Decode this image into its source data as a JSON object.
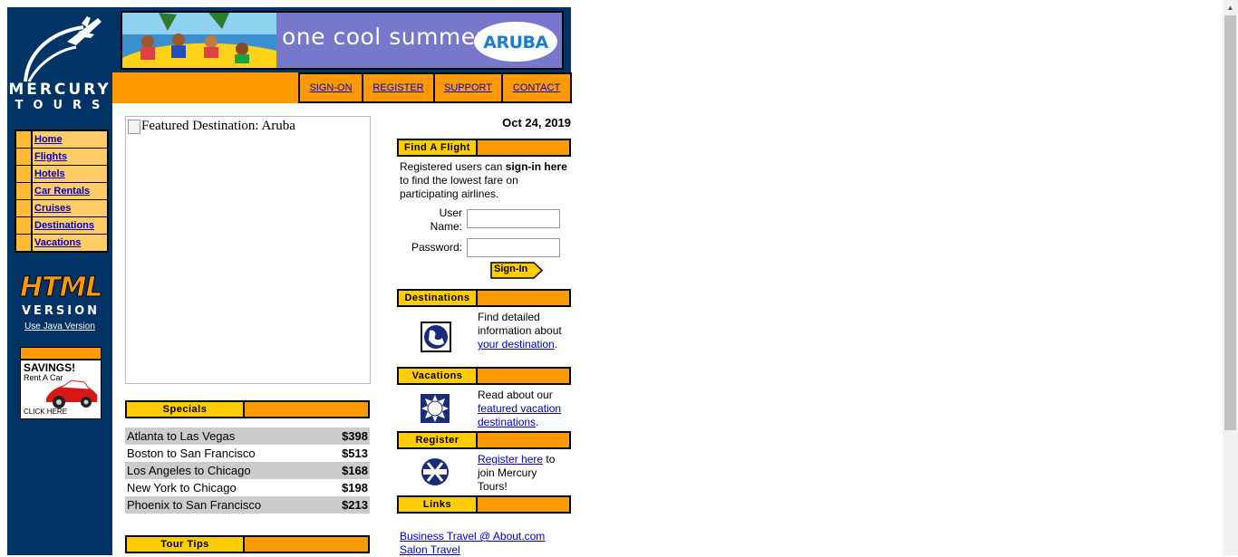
{
  "logo": {
    "line1": "MERCURY",
    "line2": "TOURS"
  },
  "nav": {
    "items": [
      {
        "label": "Home"
      },
      {
        "label": "Flights"
      },
      {
        "label": "Hotels"
      },
      {
        "label": "Car Rentals"
      },
      {
        "label": "Cruises"
      },
      {
        "label": "Destinations"
      },
      {
        "label": "Vacations"
      }
    ]
  },
  "badge": {
    "line1": "HTML",
    "line2": "VERSION",
    "java_link": "Use Java Version"
  },
  "ad": {
    "savings": "SAVINGS!",
    "rent": "Rent A Car",
    "click": "CLICK HERE"
  },
  "banner": {
    "tagline": "one cool summer",
    "logo_text": "ARUBA"
  },
  "top_links": [
    {
      "label": "SIGN-ON"
    },
    {
      "label": "REGISTER"
    },
    {
      "label": "SUPPORT"
    },
    {
      "label": "CONTACT"
    }
  ],
  "featured": {
    "alt": "Featured Destination: Aruba"
  },
  "specials": {
    "header": "Specials",
    "rows": [
      {
        "route": "Atlanta to Las Vegas",
        "price": "$398"
      },
      {
        "route": "Boston to San Francisco",
        "price": "$513"
      },
      {
        "route": "Los Angeles to Chicago",
        "price": "$168"
      },
      {
        "route": "New York to Chicago",
        "price": "$198"
      },
      {
        "route": "Phoenix to San Francisco",
        "price": "$213"
      }
    ]
  },
  "tour_tips": {
    "header": "Tour Tips"
  },
  "date": "Oct 24, 2019",
  "find_flight": {
    "header": "Find A Flight",
    "text_pre": "Registered users can ",
    "text_bold": "sign-in here",
    "text_post": " to find the lowest fare on participating airlines.",
    "username_label_1": "User",
    "username_label_2": "Name:",
    "password_label": "Password:",
    "username_value": "",
    "password_value": "",
    "signin_label": "Sign-In"
  },
  "destinations": {
    "header": "Destinations",
    "text_pre": "Find detailed information about ",
    "link": "your destination",
    "text_post": "."
  },
  "vacations": {
    "header": "Vacations",
    "text_pre": "Read about our ",
    "link": "featured vacation destinations",
    "text_post": "."
  },
  "register": {
    "header": "Register",
    "link": "Register here",
    "text_post": " to join Mercury Tours!"
  },
  "links": {
    "header": "Links",
    "items": [
      {
        "label": "Business Travel @ About.com"
      },
      {
        "label": "Salon Travel"
      }
    ]
  },
  "colors": {
    "navy": "#003366",
    "orange": "#ff9900",
    "yellow": "#ffcc00",
    "link": "#0000cc"
  }
}
